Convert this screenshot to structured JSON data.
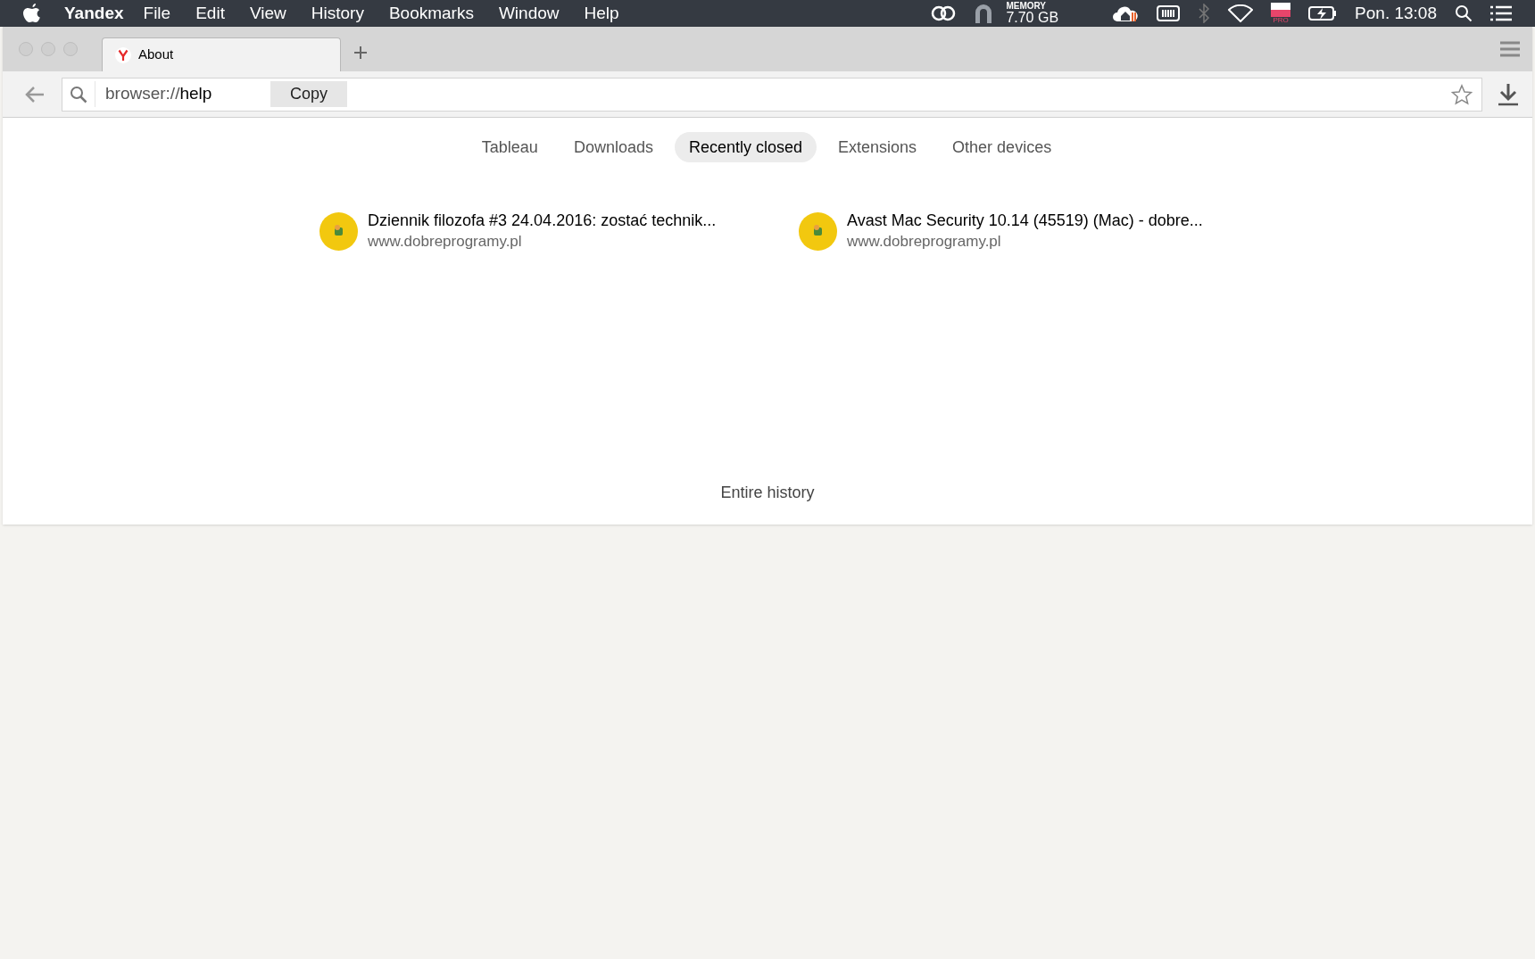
{
  "menu_bar": {
    "app": "Yandex",
    "items": [
      "File",
      "Edit",
      "View",
      "History",
      "Bookmarks",
      "Window",
      "Help"
    ],
    "memory": {
      "label": "MEMORY",
      "value": "7.70 GB"
    },
    "flag_badge": "PRO",
    "clock": "Pon. 13:08"
  },
  "browser_tabs": [
    {
      "title": "About",
      "selected": true
    }
  ],
  "address_bar": {
    "scheme": "browser://",
    "page": "help",
    "copy_button": "Copy"
  },
  "nav_tabs": [
    {
      "label": "Tableau",
      "selected": false
    },
    {
      "label": "Downloads",
      "selected": false
    },
    {
      "label": "Recently closed",
      "selected": true
    },
    {
      "label": "Extensions",
      "selected": false
    },
    {
      "label": "Other devices",
      "selected": false
    }
  ],
  "closed_pages": [
    {
      "title": "Dziennik filozofa #3 24.04.2016: zostać technik...",
      "url": "www.dobreprogramy.pl"
    },
    {
      "title": "Avast Mac Security 10.14 (45519) (Mac) - dobre...",
      "url": "www.dobreprogramy.pl"
    }
  ],
  "history_link": "Entire history"
}
